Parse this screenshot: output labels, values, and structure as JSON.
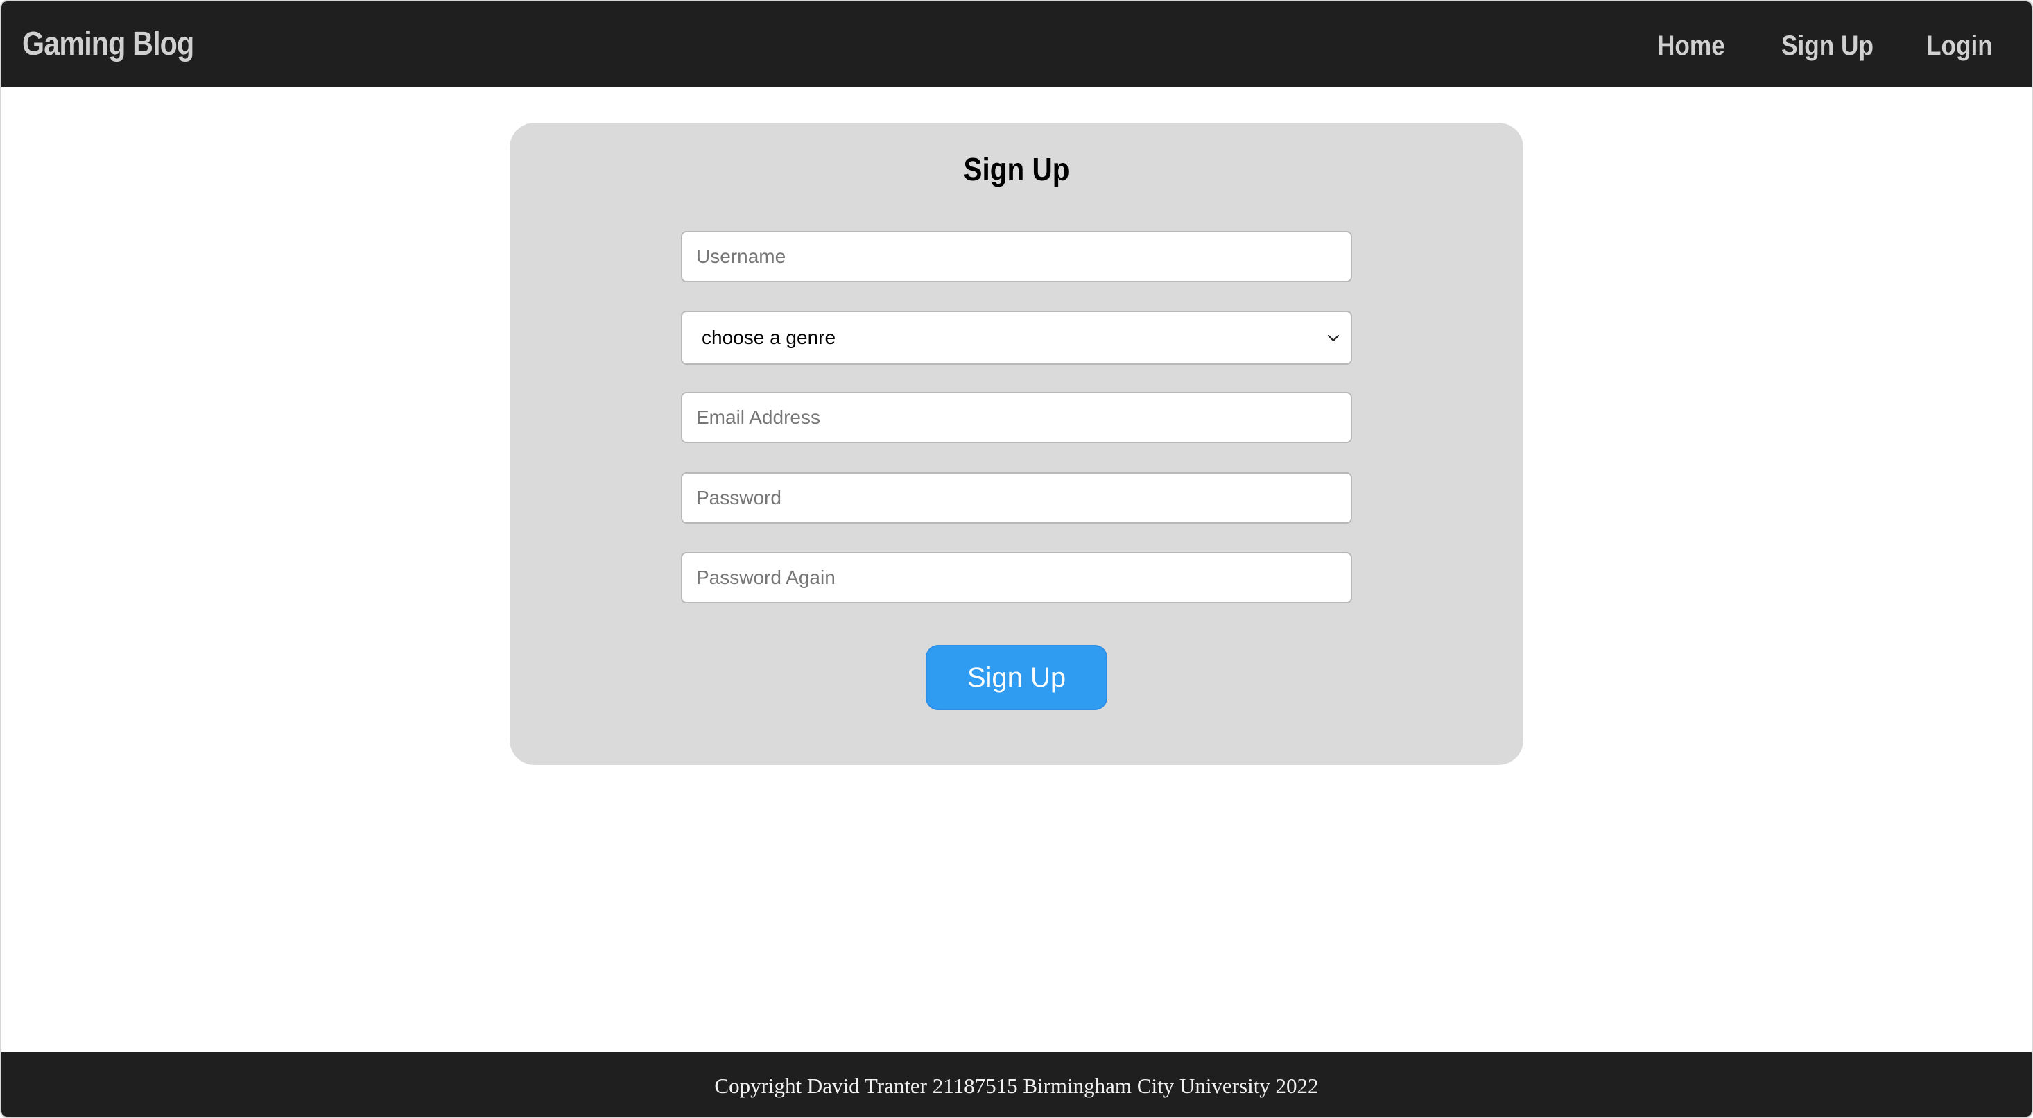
{
  "header": {
    "brand": "Gaming Blog",
    "nav": {
      "home": "Home",
      "signup": "Sign Up",
      "login": "Login"
    }
  },
  "form": {
    "title": "Sign Up",
    "username_placeholder": "Username",
    "genre_selected": "choose a genre",
    "email_placeholder": "Email Address",
    "password_placeholder": "Password",
    "password_again_placeholder": "Password Again",
    "submit_label": "Sign Up"
  },
  "footer": {
    "text": "Copyright David Tranter 21187515 Birmingham City University 2022"
  },
  "colors": {
    "navbar_bg": "#1f1f1f",
    "card_bg": "#dadada",
    "button_accent": "#2196f3"
  },
  "icons": {
    "select_chevron": "chevron-down-icon"
  }
}
